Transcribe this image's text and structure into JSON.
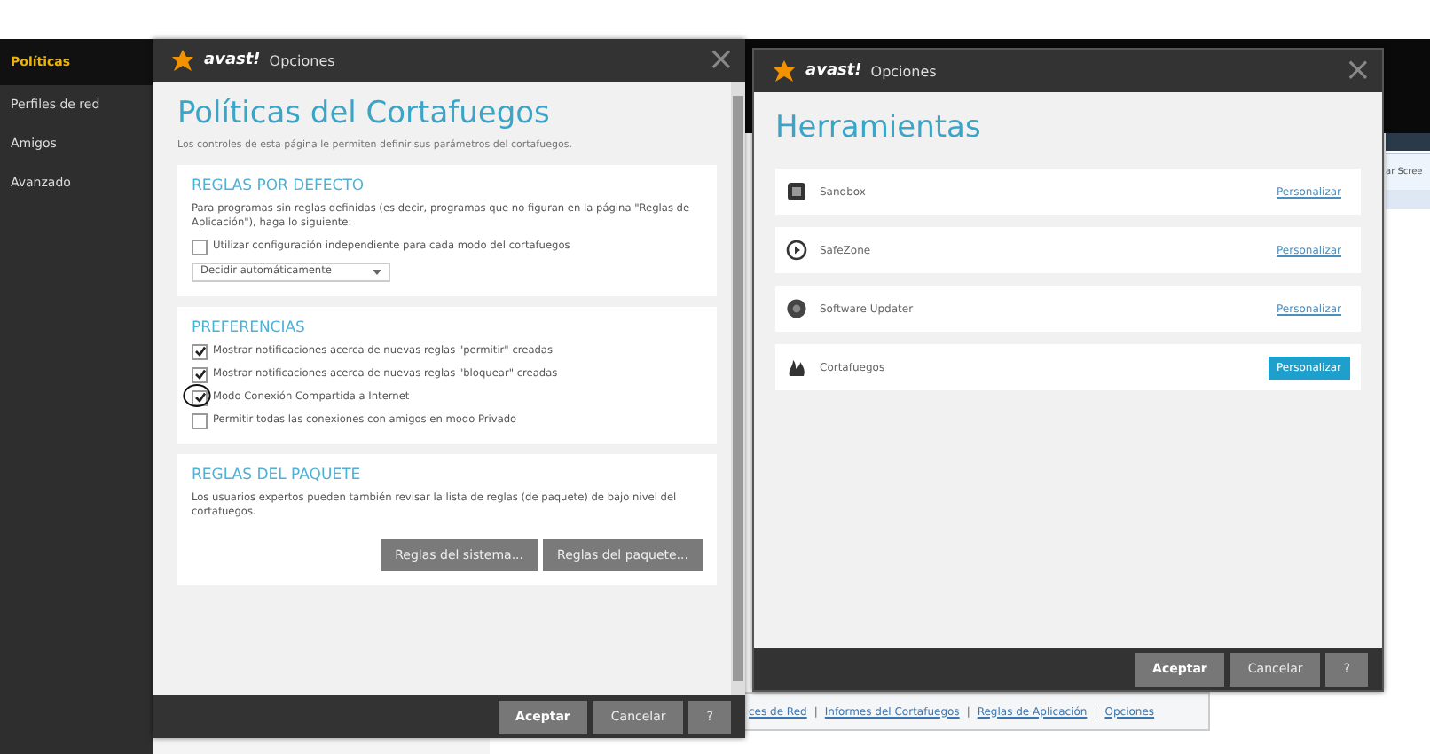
{
  "sidebar": {
    "items": [
      {
        "label": "Políticas",
        "selected": true
      },
      {
        "label": "Perfiles de red",
        "selected": false
      },
      {
        "label": "Amigos",
        "selected": false
      },
      {
        "label": "Avanzado",
        "selected": false
      }
    ]
  },
  "background": {
    "cut_text": "ar Scree",
    "separator": "|",
    "links": [
      "ces de Red",
      "Informes del Cortafuegos",
      "Reglas de Aplicación",
      "Opciones"
    ]
  },
  "policies_window": {
    "logo": "avast!",
    "title": "Opciones",
    "close": "×",
    "heading": "Políticas del Cortafuegos",
    "description": "Los controles de esta página le permiten definir sus parámetros del cortafuegos.",
    "sections": [
      {
        "title": "REGLAS POR DEFECTO",
        "text": "Para programas sin reglas definidas (es decir, programas que no figuran en la página \"Reglas de Aplicación\"), haga lo siguiente:",
        "checkboxes": [
          {
            "label": "Utilizar configuración independiente para cada modo del cortafuegos",
            "checked": false
          }
        ],
        "dropdown": {
          "value": "Decidir automáticamente"
        }
      },
      {
        "title": "PREFERENCIAS",
        "checkboxes": [
          {
            "label": "Mostrar notificaciones acerca de nuevas reglas \"permitir\" creadas",
            "checked": true
          },
          {
            "label": "Mostrar notificaciones acerca de nuevas reglas \"bloquear\" creadas",
            "checked": true
          },
          {
            "label": "Modo Conexión Compartida a Internet",
            "checked": true
          },
          {
            "label": "Permitir todas las conexiones con amigos en modo Privado",
            "checked": false
          }
        ]
      },
      {
        "title": "REGLAS DEL PAQUETE",
        "text": "Los usuarios expertos pueden también revisar la lista de reglas (de paquete) de bajo nivel del cortafuegos.",
        "buttons": [
          "Reglas del sistema...",
          "Reglas del paquete..."
        ]
      }
    ],
    "buttons": [
      "Aceptar",
      "Cancelar",
      "?"
    ]
  },
  "tools_window": {
    "logo": "avast!",
    "title": "Opciones",
    "close": "×",
    "heading": "Herramientas",
    "tools": [
      {
        "kind": "sandbox",
        "name": "Sandbox",
        "action": "Personalizar",
        "highlighted": false
      },
      {
        "kind": "safezone",
        "name": "SafeZone",
        "action": "Personalizar",
        "highlighted": false
      },
      {
        "kind": "updater",
        "name": "Software Updater",
        "action": "Personalizar",
        "highlighted": false
      },
      {
        "kind": "firewall",
        "name": "Cortafuegos",
        "action": "Personalizar",
        "highlighted": true
      }
    ],
    "buttons": [
      "Aceptar",
      "Cancelar",
      "?"
    ]
  }
}
